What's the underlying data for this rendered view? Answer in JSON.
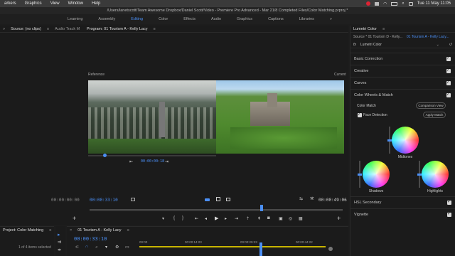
{
  "menubar": {
    "items": [
      "arkers",
      "Graphics",
      "View",
      "Window",
      "Help"
    ],
    "clock": "Tue 11 May 11:05"
  },
  "title": "/Users/lanetscott/Team Awesome Dropbox/Daniel Scott/Video - Premiere Pro Advanced - Mar 21/8 Completed Files/Color Matching.prproj *",
  "workspaces": [
    {
      "label": "Learning",
      "active": false
    },
    {
      "label": "Assembly",
      "active": false
    },
    {
      "label": "Editing",
      "active": true
    },
    {
      "label": "Color",
      "active": false
    },
    {
      "label": "Effects",
      "active": false
    },
    {
      "label": "Audio",
      "active": false
    },
    {
      "label": "Graphics",
      "active": false
    },
    {
      "label": "Captions",
      "active": false
    },
    {
      "label": "Libraries",
      "active": false
    }
  ],
  "source": {
    "tab_prev": "»",
    "tab_label": "Source: (no clips)",
    "tab_menu": "≡",
    "tab_audio": "Audio Track M",
    "timecode": "00:00:00:00"
  },
  "program": {
    "tab_label": "Program: 01 Tourism A - Kelly Lacy",
    "tab_menu": "≡",
    "reference_label": "Reference",
    "current_label": "Current",
    "ref_timecode": "00:00:00:18",
    "timecode": "00:00:33:10",
    "duration": "00:00:49:06"
  },
  "project": {
    "tab_label": "Project: Color Matching",
    "tab_menu": "≡",
    "selected_text": "1 of 4 items selected"
  },
  "timeline": {
    "tab_close": "×",
    "tab_label": "01 Tourism A - Kelly Lacy",
    "tab_menu": "≡",
    "timecode": "00:00:33:10",
    "ruler": [
      "00:00",
      "00:00:14:23",
      "00:00:29:23",
      "00:00:44:22"
    ]
  },
  "lumetri": {
    "tab_label": "Lumetri Color",
    "tab_menu": "≡",
    "master_clip": "Source * 01 Tourism D - Kelly...",
    "sequence_clip": "01 Tourism A - Kelly Lacy...",
    "fx_label": "fx",
    "effect_name": "Lumetri Color",
    "sections": [
      "Basic Correction",
      "Creative",
      "Curves",
      "Color Wheels & Match"
    ],
    "color_match_label": "Color Match",
    "comparison_view_label": "Comparison View",
    "face_detection_label": "Face Detection",
    "apply_match_label": "Apply Match",
    "wheels": {
      "midtones": "Midtones",
      "shadows": "Shadows",
      "highlights": "Highlights"
    },
    "bottom_sections": [
      "HSL Secondary",
      "Vignette"
    ],
    "accent": "#4b8ff5"
  }
}
